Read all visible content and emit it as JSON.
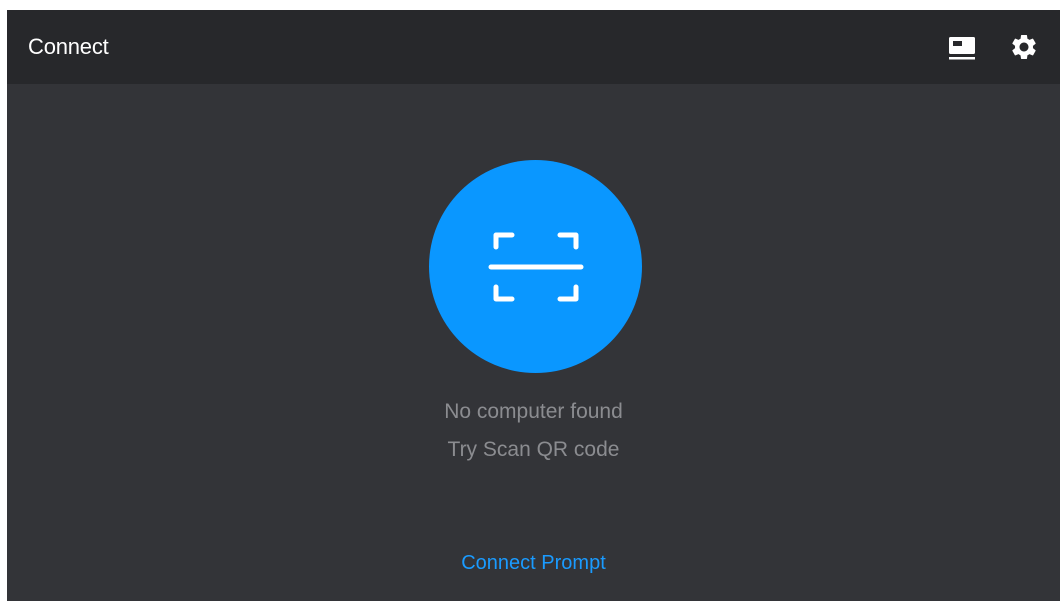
{
  "header": {
    "title": "Connect",
    "screen_icon": "screen-icon",
    "settings_icon": "gear-icon"
  },
  "main": {
    "scan_icon": "qr-scan-icon",
    "message_line1": "No computer found",
    "message_line2": "Try Scan QR code",
    "connect_prompt_label": "Connect Prompt"
  },
  "colors": {
    "header_bg": "#27282b",
    "body_bg": "#333438",
    "accent": "#0a97ff",
    "muted_text": "#8b8c90",
    "link": "#1a9bff"
  }
}
